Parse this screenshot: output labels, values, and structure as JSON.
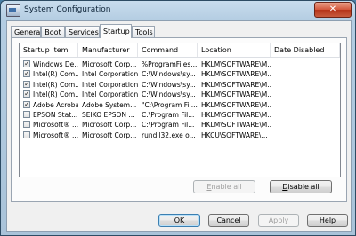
{
  "window": {
    "title": "System Configuration",
    "close_glyph": "✕"
  },
  "tabs": [
    "General",
    "Boot",
    "Services",
    "Startup",
    "Tools"
  ],
  "active_tab": "Startup",
  "columns": [
    "Startup Item",
    "Manufacturer",
    "Command",
    "Location",
    "Date Disabled"
  ],
  "rows": [
    {
      "checked": true,
      "item": "Windows De...",
      "manufacturer": "Microsoft Corp...",
      "command": "%ProgramFiles...",
      "location": "HKLM\\SOFTWARE\\M...",
      "date": ""
    },
    {
      "checked": true,
      "item": "Intel(R) Com...",
      "manufacturer": "Intel Corporation",
      "command": "C:\\Windows\\sy...",
      "location": "HKLM\\SOFTWARE\\M...",
      "date": ""
    },
    {
      "checked": true,
      "item": "Intel(R) Com...",
      "manufacturer": "Intel Corporation",
      "command": "C:\\Windows\\sy...",
      "location": "HKLM\\SOFTWARE\\M...",
      "date": ""
    },
    {
      "checked": true,
      "item": "Intel(R) Com...",
      "manufacturer": "Intel Corporation",
      "command": "C:\\Windows\\sy...",
      "location": "HKLM\\SOFTWARE\\M...",
      "date": ""
    },
    {
      "checked": true,
      "item": "Adobe Acrobat",
      "manufacturer": "Adobe System...",
      "command": "\"C:\\Program Fil...",
      "location": "HKLM\\SOFTWARE\\M...",
      "date": ""
    },
    {
      "checked": false,
      "item": "EPSON Stat...",
      "manufacturer": "SEIKO EPSON ...",
      "command": "C:\\Program Fil...",
      "location": "HKLM\\SOFTWARE\\M...",
      "date": ""
    },
    {
      "checked": false,
      "item": "Microsoft® ...",
      "manufacturer": "Microsoft Corp...",
      "command": "C:\\Program Fil...",
      "location": "HKLM\\SOFTWARE\\M...",
      "date": ""
    },
    {
      "checked": false,
      "item": "Microsoft® ...",
      "manufacturer": "Microsoft Corp...",
      "command": "rundll32.exe o...",
      "location": "HKCU\\SOFTWARE\\...",
      "date": ""
    }
  ],
  "buttons": {
    "enable_all": "Enable all",
    "disable_all": "Disable all",
    "ok": "OK",
    "cancel": "Cancel",
    "apply": "Apply",
    "help": "Help"
  }
}
